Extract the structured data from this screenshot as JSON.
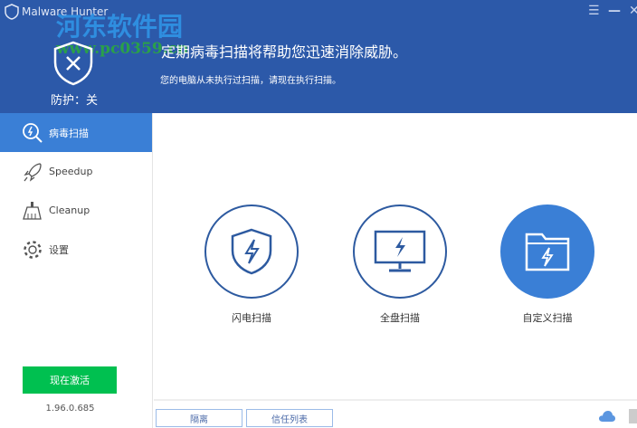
{
  "app": {
    "title": "Malware Hunter",
    "protection_status": "防护：关"
  },
  "watermark": {
    "name": "河东软件园",
    "url": "www.pc0359.cn"
  },
  "header": {
    "headline": "定期病毒扫描将帮助您迅速消除威胁。",
    "subline": "您的电脑从未执行过扫描，请现在执行扫描。"
  },
  "sidebar": {
    "items": [
      {
        "label": "病毒扫描",
        "icon": "scan-icon"
      },
      {
        "label": "Speedup",
        "icon": "rocket-icon"
      },
      {
        "label": "Cleanup",
        "icon": "broom-icon"
      },
      {
        "label": "设置",
        "icon": "gear-icon"
      }
    ],
    "activate_label": "现在激活",
    "version": "1.96.0.685"
  },
  "main": {
    "scans": [
      {
        "label": "闪电扫描",
        "icon": "shield-bolt-icon"
      },
      {
        "label": "全盘扫描",
        "icon": "monitor-bolt-icon"
      },
      {
        "label": "自定义扫描",
        "icon": "folder-bolt-icon"
      }
    ]
  },
  "bottom": {
    "quarantine_label": "隔离",
    "trust_list_label": "信任列表"
  },
  "colors": {
    "header": "#2c59a9",
    "accent": "#3a7fd6",
    "activate": "#00c050"
  }
}
